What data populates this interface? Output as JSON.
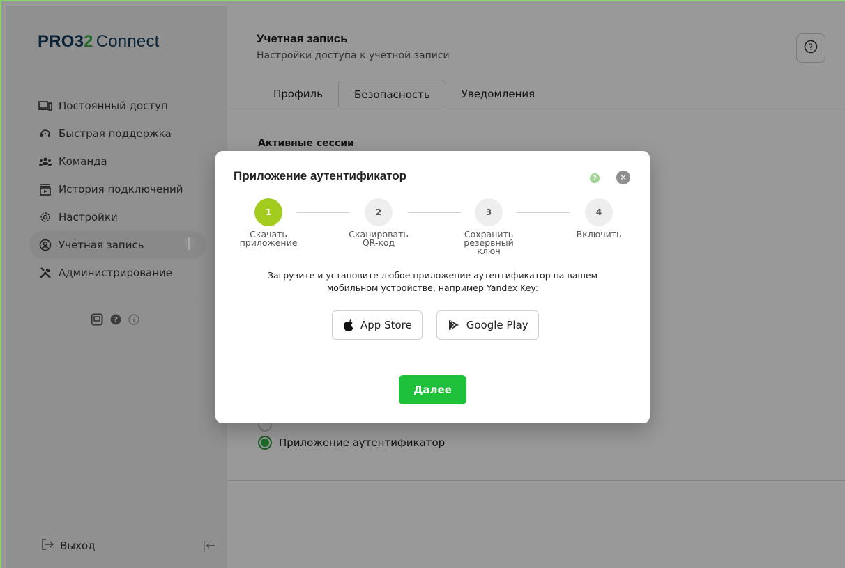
{
  "app": {
    "logo_brand": "PRO3",
    "logo_two": "2",
    "logo_name": "Connect"
  },
  "sidebar": {
    "items": [
      {
        "label": "Постоянный доступ",
        "icon": "devices-icon"
      },
      {
        "label": "Быстрая поддержка",
        "icon": "headset-icon"
      },
      {
        "label": "Команда",
        "icon": "team-icon"
      },
      {
        "label": "История подключений",
        "icon": "history-icon"
      },
      {
        "label": "Настройки",
        "icon": "gear-icon"
      },
      {
        "label": "Учетная запись",
        "icon": "user-icon",
        "active": true,
        "badge_icon": "shield-icon"
      },
      {
        "label": "Администрирование",
        "icon": "tools-icon"
      }
    ],
    "logout": "Выход"
  },
  "page": {
    "title": "Учетная запись",
    "subtitle": "Настройки доступа к учетной записи",
    "tabs": [
      "Профиль",
      "Безопасность",
      "Уведомления"
    ],
    "active_tab": "Безопасность",
    "section_title": "Активные сессии",
    "radio_selected_label": "Приложение аутентификатор"
  },
  "modal": {
    "title": "Приложение аутентификатор",
    "steps": [
      {
        "num": "1",
        "label": "Скачать\nприложение",
        "active": true
      },
      {
        "num": "2",
        "label": "Сканировать\nQR-код",
        "active": false
      },
      {
        "num": "3",
        "label": "Сохранить\nрезервный\nключ",
        "active": false
      },
      {
        "num": "4",
        "label": "Включить",
        "active": false
      }
    ],
    "description_line1": "Загрузите и установите любое приложение аутентификатор на вашем",
    "description_line2": "мобильном устройстве, например Yandex Key:",
    "app_store": "App Store",
    "google_play": "Google Play",
    "next": "Далее"
  },
  "colors": {
    "accent_green": "#1fc13b",
    "step_active": "#a3cc1e",
    "brand_navy": "#103b5c"
  }
}
